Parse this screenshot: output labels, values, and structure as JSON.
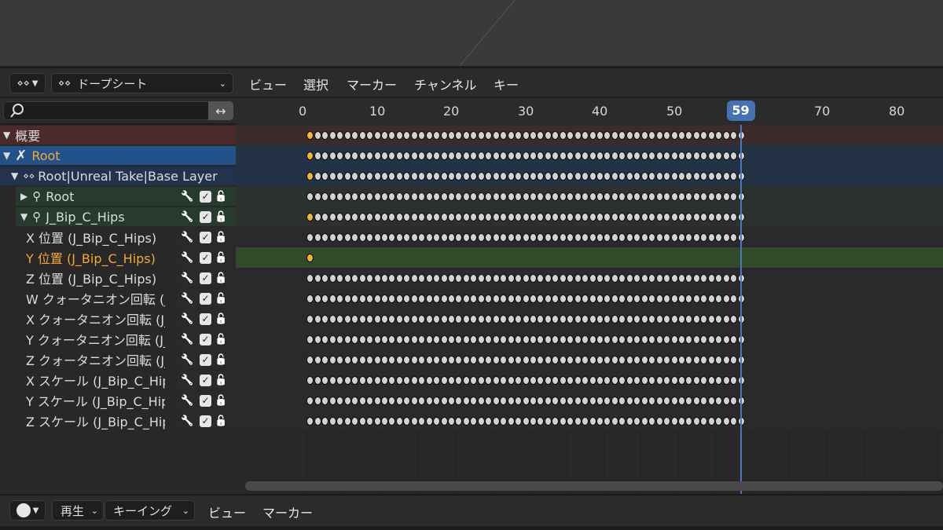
{
  "header": {
    "editor_type_icon": "dopesheet-icon",
    "mode_label": "ドープシート",
    "menus": [
      "ビュー",
      "選択",
      "マーカー",
      "チャンネル",
      "キー"
    ]
  },
  "search": {
    "placeholder": "",
    "value": ""
  },
  "ruler": {
    "ticks": [
      "0",
      "10",
      "20",
      "30",
      "40",
      "50",
      "70",
      "80"
    ]
  },
  "playhead": {
    "frame": 59,
    "label": "59"
  },
  "colors": {
    "summary_row": "#4a2b2b",
    "object_row": "#23528a",
    "action_row": "#22344d",
    "group_row": "#273a30",
    "selected_channel": "#314a2a",
    "selected_text": "#f2a933",
    "keyframe": "#d2d2d2",
    "keyframe_selected": "#f5b537",
    "playhead": "#4672b4"
  },
  "channels": [
    {
      "label": "概要",
      "kind": "summary"
    },
    {
      "label": "Root",
      "kind": "object"
    },
    {
      "label": "Root|Unreal Take|Base Layer",
      "kind": "action"
    },
    {
      "label": "Root",
      "kind": "group"
    },
    {
      "label": "J_Bip_C_Hips",
      "kind": "group"
    },
    {
      "label": "X 位置 (J_Bip_C_Hips)",
      "kind": "fcurve"
    },
    {
      "label": "Y 位置 (J_Bip_C_Hips)",
      "kind": "fcurve-selected"
    },
    {
      "label": "Z 位置 (J_Bip_C_Hips)",
      "kind": "fcurve"
    },
    {
      "label": "W クォータニオン回転 (J_Bip_C_Hips)",
      "kind": "fcurve"
    },
    {
      "label": "X クォータニオン回転 (J_Bip_C_Hips)",
      "kind": "fcurve"
    },
    {
      "label": "Y クォータニオン回転 (J_Bip_C_Hips)",
      "kind": "fcurve"
    },
    {
      "label": "Z クォータニオン回転 (J_Bip_C_Hips)",
      "kind": "fcurve"
    },
    {
      "label": "X スケール (J_Bip_C_Hips)",
      "kind": "fcurve"
    },
    {
      "label": "Y スケール (J_Bip_C_Hips)",
      "kind": "fcurve"
    },
    {
      "label": "Z スケール (J_Bip_C_Hips)",
      "kind": "fcurve"
    }
  ],
  "keyframes": {
    "first_frame": 1,
    "last_frame": 59,
    "single_key_rows": [
      6
    ],
    "first_selected_rows": [
      0,
      1,
      2,
      4,
      6
    ]
  },
  "footer": {
    "playback_label": "再生",
    "keying_label": "キーイング",
    "menus": [
      "ビュー",
      "マーカー"
    ]
  }
}
